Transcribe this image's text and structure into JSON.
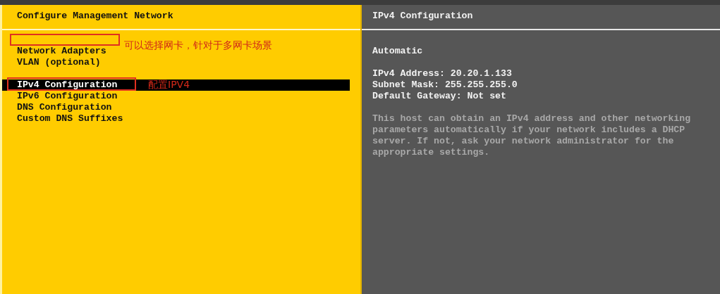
{
  "left_panel": {
    "title": "Configure Management Network",
    "menu_groups": [
      {
        "items": [
          {
            "label": "Network Adapters",
            "selected": false
          },
          {
            "label": "VLAN (optional)",
            "selected": false
          }
        ]
      },
      {
        "items": [
          {
            "label": "IPv4 Configuration",
            "selected": true
          },
          {
            "label": "IPv6 Configuration",
            "selected": false
          },
          {
            "label": "DNS Configuration",
            "selected": false
          },
          {
            "label": "Custom DNS Suffixes",
            "selected": false
          }
        ]
      }
    ]
  },
  "right_panel": {
    "title": "IPv4 Configuration",
    "mode": "Automatic",
    "details": [
      "IPv4 Address: 20.20.1.133",
      "Subnet Mask: 255.255.255.0",
      "Default Gateway: Not set"
    ],
    "description": "This host can obtain an IPv4 address and other networking parameters automatically if your network includes a DHCP server. If not, ask your network administrator for the appropriate settings."
  },
  "annotations": [
    {
      "text": "可以选择网卡，针对于多网卡场景"
    },
    {
      "text": "配置IPV4"
    }
  ]
}
